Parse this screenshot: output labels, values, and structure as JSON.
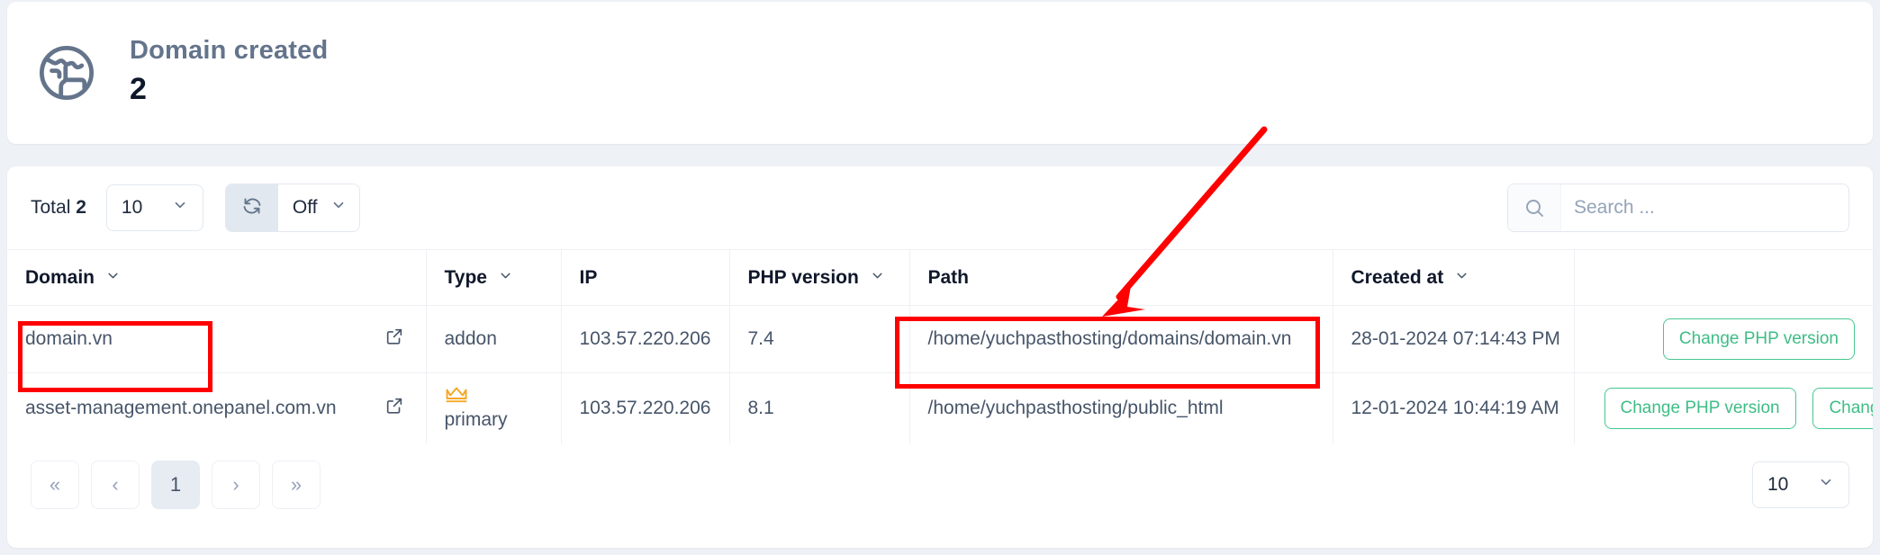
{
  "summary": {
    "icon": "globe-icon",
    "title": "Domain created",
    "value": "2"
  },
  "toolbar": {
    "total_prefix": "Total",
    "total_count": "2",
    "page_size": "10",
    "refresh_icon": "refresh-icon",
    "auto_refresh": "Off",
    "search_icon": "search-icon",
    "search_value": "",
    "search_placeholder": "Search ..."
  },
  "table": {
    "columns": [
      {
        "label": "Domain",
        "sortable": true
      },
      {
        "label": "Type",
        "sortable": true
      },
      {
        "label": "IP",
        "sortable": false
      },
      {
        "label": "PHP version",
        "sortable": true
      },
      {
        "label": "Path",
        "sortable": false
      },
      {
        "label": "Created at",
        "sortable": true
      },
      {
        "label": "",
        "sortable": false
      }
    ],
    "rows": [
      {
        "domain": "domain.vn",
        "external_link_icon": "external-link-icon",
        "type": "addon",
        "type_badge_icon": "",
        "ip": "103.57.220.206",
        "php_version": "7.4",
        "path": "/home/yuchpasthosting/domains/domain.vn",
        "created_at": "28-01-2024 07:14:43 PM",
        "actions": [
          "Change PHP version"
        ]
      },
      {
        "domain": "asset-management.onepanel.com.vn",
        "external_link_icon": "external-link-icon",
        "type": "primary",
        "type_badge_icon": "crown-icon",
        "ip": "103.57.220.206",
        "php_version": "8.1",
        "path": "/home/yuchpasthosting/public_html",
        "created_at": "12-01-2024 10:44:19 AM",
        "actions": [
          "Change PHP version",
          "Change IP"
        ]
      }
    ]
  },
  "pagination": {
    "first": "«",
    "prev": "‹",
    "current_page": "1",
    "next": "›",
    "last": "»",
    "page_size": "10"
  },
  "annotations": {
    "highlight_color": "#ff0000",
    "boxes": [
      "domain-cell-highlight",
      "path-cell-highlight"
    ],
    "arrow": "arrow-pointing-to-path"
  },
  "colors": {
    "page_background": "#eef1f6",
    "card_background": "#ffffff",
    "accent_green": "#3ebd86",
    "crown_amber": "#f5a623",
    "heading_slate": "#64748b",
    "annotation_red": "#ff0000"
  }
}
